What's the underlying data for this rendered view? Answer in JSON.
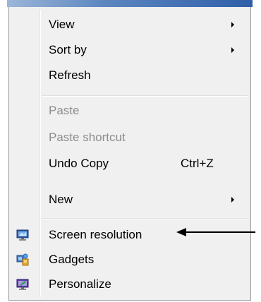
{
  "menu": {
    "items": [
      {
        "label": "View",
        "submenu": true
      },
      {
        "label": "Sort by",
        "submenu": true
      },
      {
        "label": "Refresh"
      },
      {
        "label": "Paste",
        "disabled": true
      },
      {
        "label": "Paste shortcut",
        "disabled": true
      },
      {
        "label": "Undo Copy",
        "shortcut": "Ctrl+Z"
      },
      {
        "label": "New",
        "submenu": true
      },
      {
        "label": "Screen resolution",
        "icon": "monitor-icon"
      },
      {
        "label": "Gadgets",
        "icon": "gadgets-icon"
      },
      {
        "label": "Personalize",
        "icon": "personalize-icon"
      }
    ]
  },
  "annotation": {
    "pointer": "black-arrow-pointing-left",
    "target": "Screen resolution"
  },
  "colors": {
    "menu_bg": "#f0f0f0",
    "menu_border": "#979797",
    "disabled_text": "#8d8d8d",
    "title_strip": "#2f5fa9"
  }
}
